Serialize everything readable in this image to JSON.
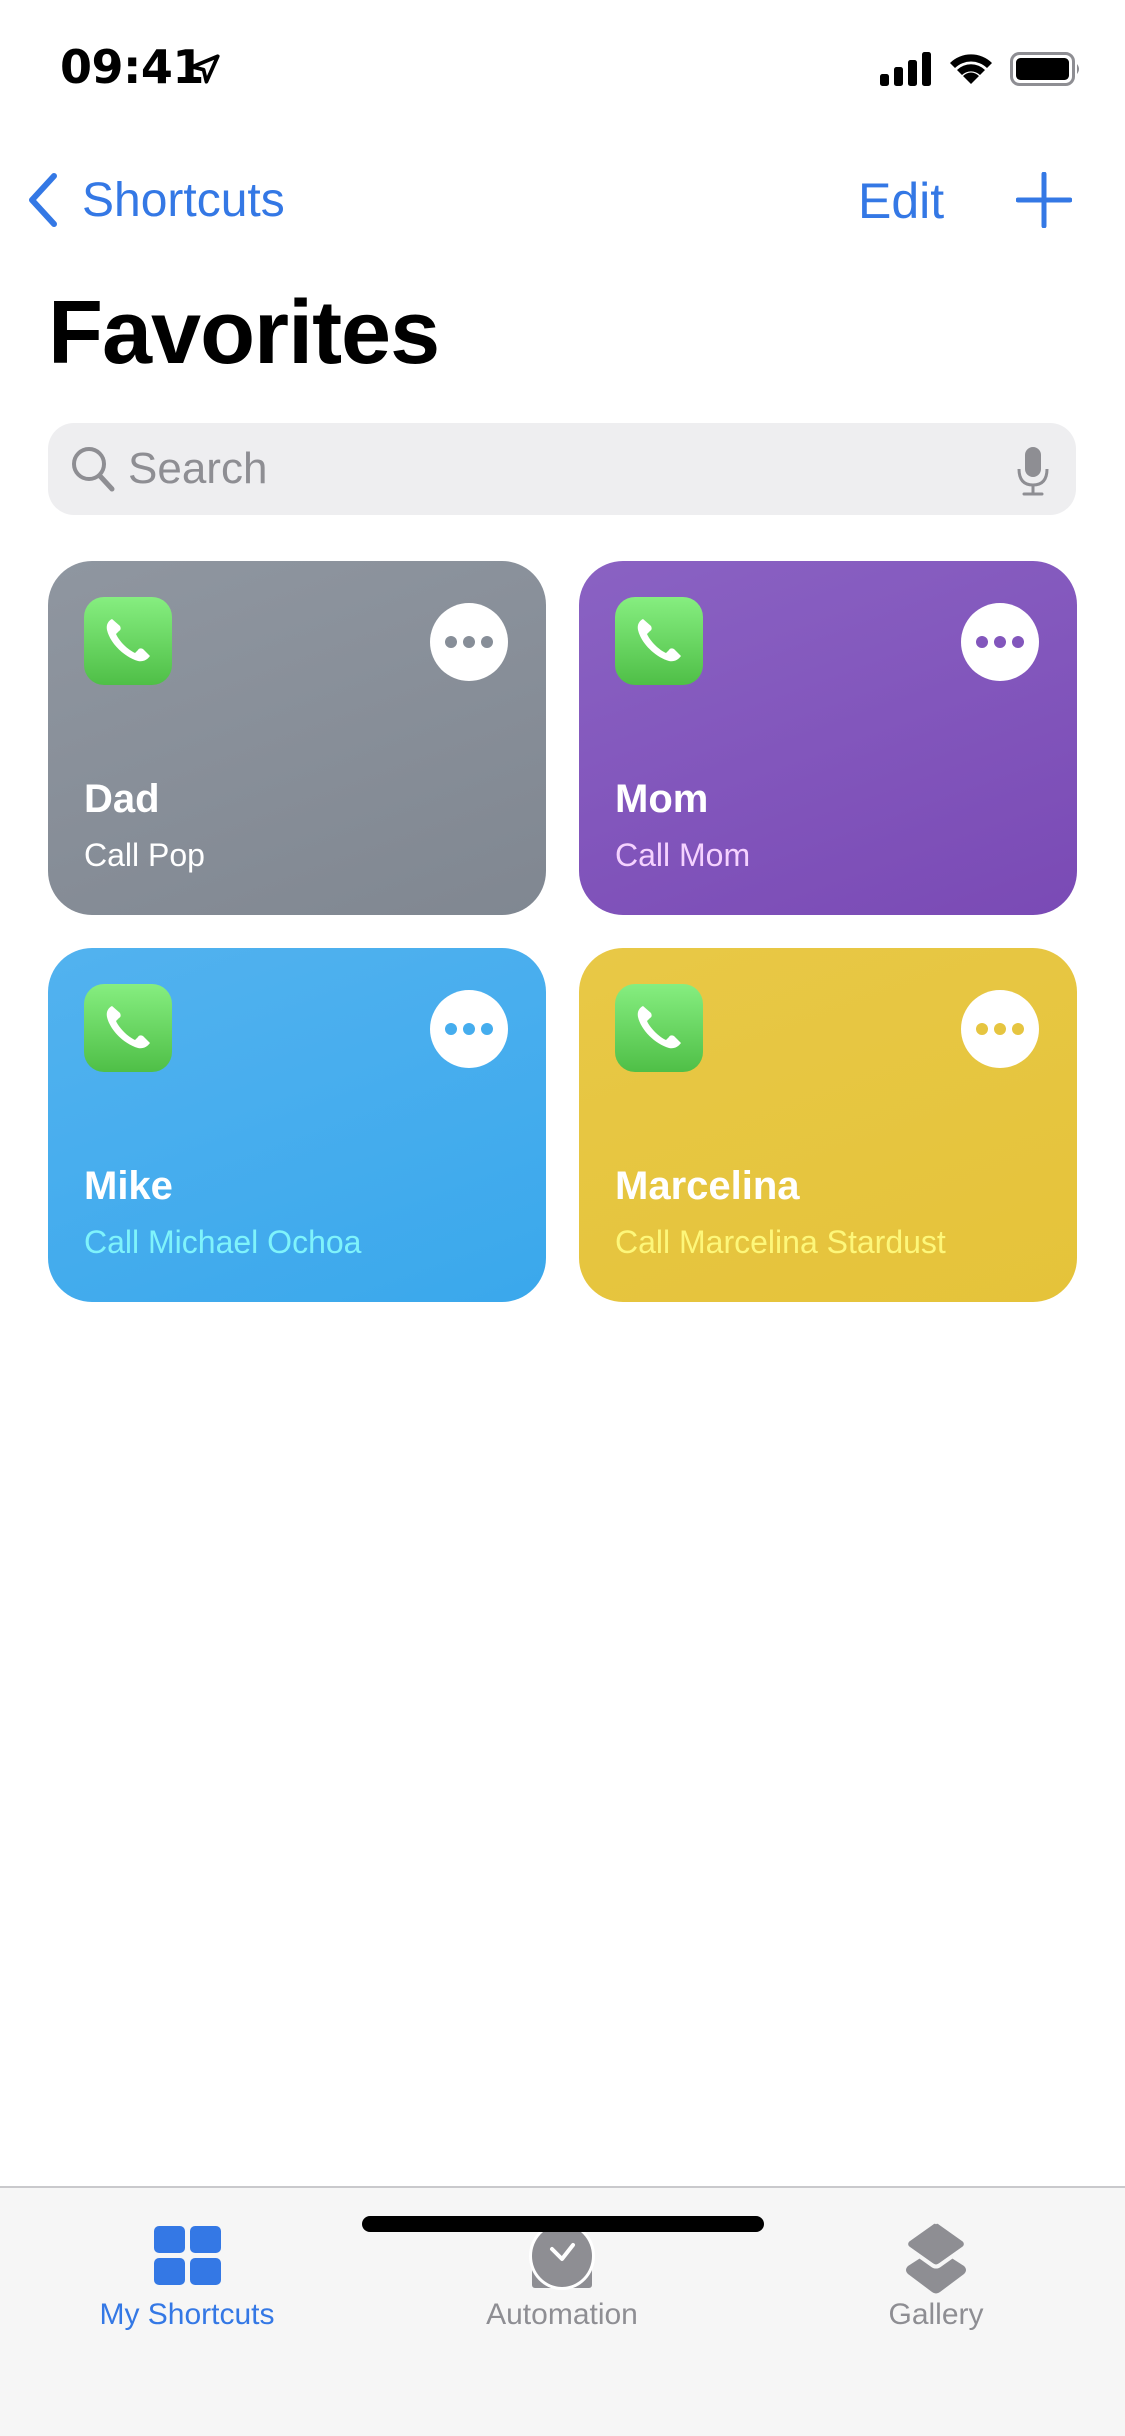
{
  "status_bar": {
    "time": "09:41",
    "icons": [
      "location-arrow-icon",
      "cellular-signal-icon",
      "wifi-icon",
      "battery-icon"
    ]
  },
  "nav": {
    "back_label": "Shortcuts",
    "edit_label": "Edit",
    "add_icon": "plus-icon"
  },
  "page": {
    "title": "Favorites"
  },
  "search": {
    "placeholder": "Search",
    "value": ""
  },
  "accent_color": "#3478e5",
  "shortcuts": [
    {
      "name": "Dad",
      "subtitle": "Call Pop",
      "color": "#878e98",
      "subtitle_color": "#ffffff",
      "dot_color": "#878e98",
      "icon": "phone-icon"
    },
    {
      "name": "Mom",
      "subtitle": "Call Mom",
      "color": "#8256bc",
      "subtitle_color": "#f5d2ff",
      "dot_color": "#8256bc",
      "icon": "phone-icon"
    },
    {
      "name": "Mike",
      "subtitle": "Call Michael Ochoa",
      "color": "#45adee",
      "subtitle_color": "#7ff3fb",
      "dot_color": "#45adee",
      "icon": "phone-icon"
    },
    {
      "name": "Marcelina",
      "subtitle": "Call Marcelina Stardust",
      "color": "#e6c540",
      "subtitle_color": "#fdf77a",
      "dot_color": "#e6c540",
      "icon": "phone-icon"
    }
  ],
  "tabs": [
    {
      "label": "My Shortcuts",
      "icon": "grid-icon",
      "active": true
    },
    {
      "label": "Automation",
      "icon": "clock-check-icon",
      "active": false
    },
    {
      "label": "Gallery",
      "icon": "layers-icon",
      "active": false
    }
  ]
}
